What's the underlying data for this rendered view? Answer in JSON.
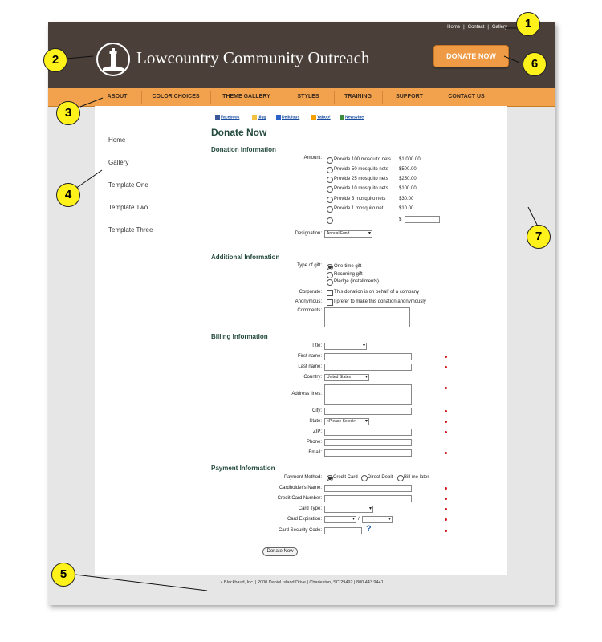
{
  "top_links": [
    "Home",
    "Contact",
    "Gallery"
  ],
  "site_name": "Lowcountry Community Outreach",
  "donate_now_button": "DONATE NOW",
  "nav": [
    "ABOUT",
    "COLOR CHOICES",
    "THEME GALLERY",
    "STYLES",
    "TRAINING",
    "SUPPORT",
    "CONTACT US"
  ],
  "sidebar": [
    "Home",
    "Gallery",
    "Template One",
    "Template Two",
    "Template Three"
  ],
  "share": [
    "Facebook",
    "digg",
    "Delicious",
    "Yahoo!",
    "Newsvine"
  ],
  "page_title": "Donate Now",
  "donation": {
    "heading": "Donation Information",
    "amount_label": "Amount:",
    "options": [
      {
        "label": "Provide 100 mosquito nets",
        "amount": "$1,000.00"
      },
      {
        "label": "Provide 50 mosquito nets",
        "amount": "$500.00"
      },
      {
        "label": "Provide 25 mosquito nets",
        "amount": "$250.00"
      },
      {
        "label": "Provide 10 mosquito nets",
        "amount": "$100.00"
      },
      {
        "label": "Provide 3 mosquito nets",
        "amount": "$30.00"
      },
      {
        "label": "Provide 1 mosquito net",
        "amount": "$10.00"
      }
    ],
    "other_currency": "$",
    "designation_label": "Designation:",
    "designation_value": "Annual Fund"
  },
  "additional": {
    "heading": "Additional Information",
    "type_label": "Type of gift:",
    "types": [
      "One-time gift",
      "Recurring gift",
      "Pledge (installments)"
    ],
    "corporate_label": "Corporate:",
    "corporate_text": "This donation is on behalf of a company",
    "anonymous_label": "Anonymous:",
    "anonymous_text": "I prefer to make this donation anonymously",
    "comments_label": "Comments:"
  },
  "billing": {
    "heading": "Billing Information",
    "title_label": "Title:",
    "first_label": "First name:",
    "last_label": "Last name:",
    "country_label": "Country:",
    "country_value": "United States",
    "address_label": "Address lines:",
    "city_label": "City:",
    "state_label": "State:",
    "state_value": "<Please Select>",
    "zip_label": "ZIP:",
    "phone_label": "Phone:",
    "email_label": "Email:"
  },
  "payment": {
    "heading": "Payment Information",
    "method_label": "Payment Method:",
    "methods": [
      "Credit Card",
      "Direct Debit",
      "Bill me later"
    ],
    "cardholder_label": "Cardholder's Name:",
    "number_label": "Credit Card Number:",
    "type_label": "Card Type:",
    "expiration_label": "Card Expiration:",
    "expiration_sep": "/",
    "security_label": "Card Security Code:",
    "help_icon": "?"
  },
  "submit_button": "Donate Now",
  "footer": "» Blackbaud, Inc. | 2000 Daniel Island Drive | Charleston, SC 29492 | 800.443.9441",
  "callouts": [
    "1",
    "2",
    "3",
    "4",
    "5",
    "6",
    "7"
  ]
}
